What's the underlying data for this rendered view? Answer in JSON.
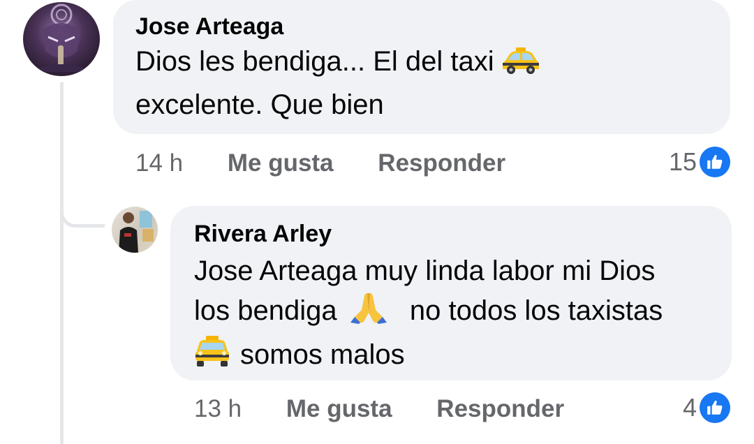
{
  "colors": {
    "bubble": "#f0f2f5",
    "secondary_text": "#65676b",
    "like_blue": "#1877f2",
    "thread_line": "#e4e6e9"
  },
  "comments": [
    {
      "author": "Jose Arteaga",
      "text_line1": "Dios les bendiga... El del taxi",
      "text_line2": "excelente. Que bien",
      "emoji": "taxi-icon",
      "time": "14 h",
      "like_label": "Me gusta",
      "reply_label": "Responder",
      "reaction_count": "15"
    },
    {
      "author": "Rivera Arley",
      "text_line1": "Jose Arteaga muy linda labor mi Dios",
      "text_line2a": "los bendiga",
      "text_line2b": "no todos los taxistas",
      "text_line3": "somos malos",
      "emojis": [
        "praying-hands-icon",
        "taxi-icon"
      ],
      "time": "13 h",
      "like_label": "Me gusta",
      "reply_label": "Responder",
      "reaction_count": "4"
    }
  ]
}
